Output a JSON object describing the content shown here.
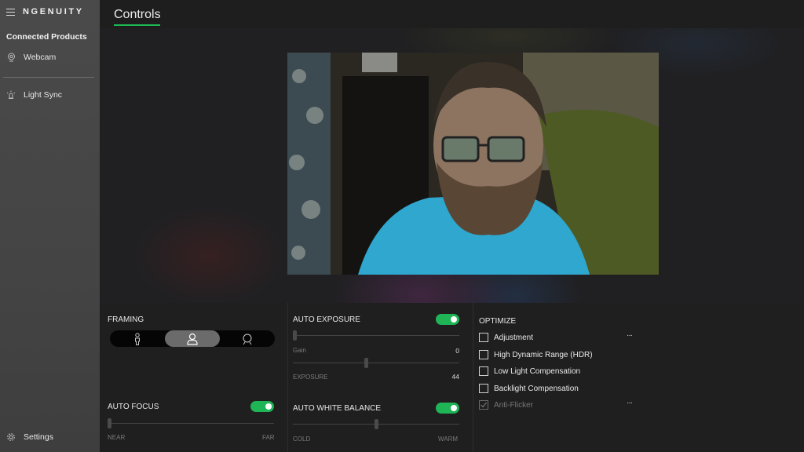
{
  "app": {
    "brand": "NGENUITY"
  },
  "sidebar": {
    "section_title": "Connected Products",
    "items": [
      {
        "label": "Webcam",
        "icon": "webcam-icon"
      },
      {
        "label": "Light Sync",
        "icon": "light-icon"
      }
    ],
    "settings_label": "Settings"
  },
  "header": {
    "tabs": [
      {
        "label": "Controls",
        "active": true
      }
    ]
  },
  "colors": {
    "accent": "#1db954",
    "toggle_on": "#1fb456",
    "sidebar_bg": "#474747",
    "panel_bg": "#1f1f1f"
  },
  "preview": {
    "label": "webcam-preview"
  },
  "framing": {
    "title": "FRAMING",
    "options": [
      "full-body",
      "upper-body",
      "head"
    ],
    "selected": "upper-body"
  },
  "auto_focus": {
    "title": "AUTO FOCUS",
    "enabled": true,
    "slider_value_fraction": 0.0,
    "min_label": "NEAR",
    "max_label": "FAR"
  },
  "auto_exposure": {
    "title": "AUTO EXPOSURE",
    "enabled": true,
    "gain_label": "Gain",
    "gain_value": "0",
    "gain_fraction": 0.0,
    "exposure_label": "EXPOSURE",
    "exposure_value": "44",
    "exposure_fraction": 0.44
  },
  "auto_white_balance": {
    "title": "AUTO WHITE BALANCE",
    "enabled": true,
    "slider_value_fraction": 0.5,
    "min_label": "COLD",
    "max_label": "WARM"
  },
  "optimize": {
    "title": "OPTIMIZE",
    "more_label": "···",
    "items": [
      {
        "label": "Adjustment",
        "checked": false,
        "disabled": false,
        "has_more": true
      },
      {
        "label": "High Dynamic Range (HDR)",
        "checked": false,
        "disabled": false,
        "has_more": false
      },
      {
        "label": "Low Light Compensation",
        "checked": false,
        "disabled": false,
        "has_more": false
      },
      {
        "label": "Backlight Compensation",
        "checked": false,
        "disabled": false,
        "has_more": false
      },
      {
        "label": "Anti-Flicker",
        "checked": true,
        "disabled": true,
        "has_more": true
      }
    ]
  }
}
